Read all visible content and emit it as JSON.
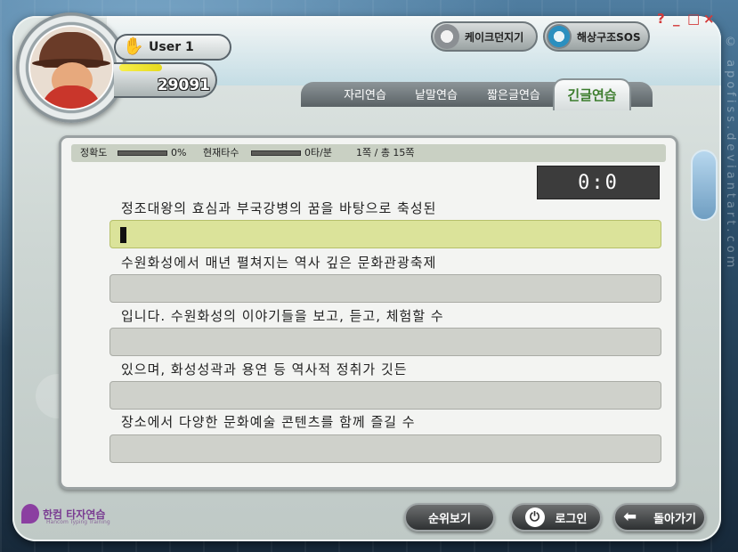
{
  "window_controls": {
    "help": "?",
    "minimize": "_",
    "maximize": "□",
    "close": "×"
  },
  "user": {
    "name": "User 1",
    "score": "29091",
    "progress": 0.45
  },
  "games": [
    {
      "label": "케이크던지기",
      "icon": "cake-icon"
    },
    {
      "label": "해상구조SOS",
      "icon": "lifebuoy-icon"
    }
  ],
  "tabs": [
    {
      "label": "자리연습",
      "active": false
    },
    {
      "label": "낱말연습",
      "active": false
    },
    {
      "label": "짧은글연습",
      "active": false
    },
    {
      "label": "긴글연습",
      "active": true
    }
  ],
  "stats": {
    "accuracy_label": "정확도",
    "accuracy_value": "0%",
    "speed_label": "현재타수",
    "speed_value": "0타/분",
    "page_info": "1쪽 / 총 15쪽"
  },
  "timer": "0:0",
  "lines": [
    {
      "prompt": "정조대왕의 효심과 부국강병의 꿈을 바탕으로 축성된",
      "value": ""
    },
    {
      "prompt": "수원화성에서 매년 펼쳐지는 역사 깊은 문화관광축제",
      "value": ""
    },
    {
      "prompt": "입니다. 수원화성의 이야기들을 보고, 듣고, 체험할 수",
      "value": ""
    },
    {
      "prompt": "있으며, 화성성곽과 용연 등 역사적 정취가 깃든",
      "value": ""
    },
    {
      "prompt": "장소에서 다양한 문화예술 콘텐츠를 함께 즐길 수",
      "value": ""
    }
  ],
  "footer": {
    "logo_text": "한컴 타자연습",
    "logo_sub": "Hancom Typing Training",
    "ranking_button": "순위보기",
    "login_button": "로그인",
    "back_button": "돌아가기"
  },
  "watermark": "© apofiss.deviantart.com",
  "colors": {
    "active_tab_text": "#3d7d2e",
    "active_input": "#dbe39a",
    "close_red": "#d33a3a"
  }
}
